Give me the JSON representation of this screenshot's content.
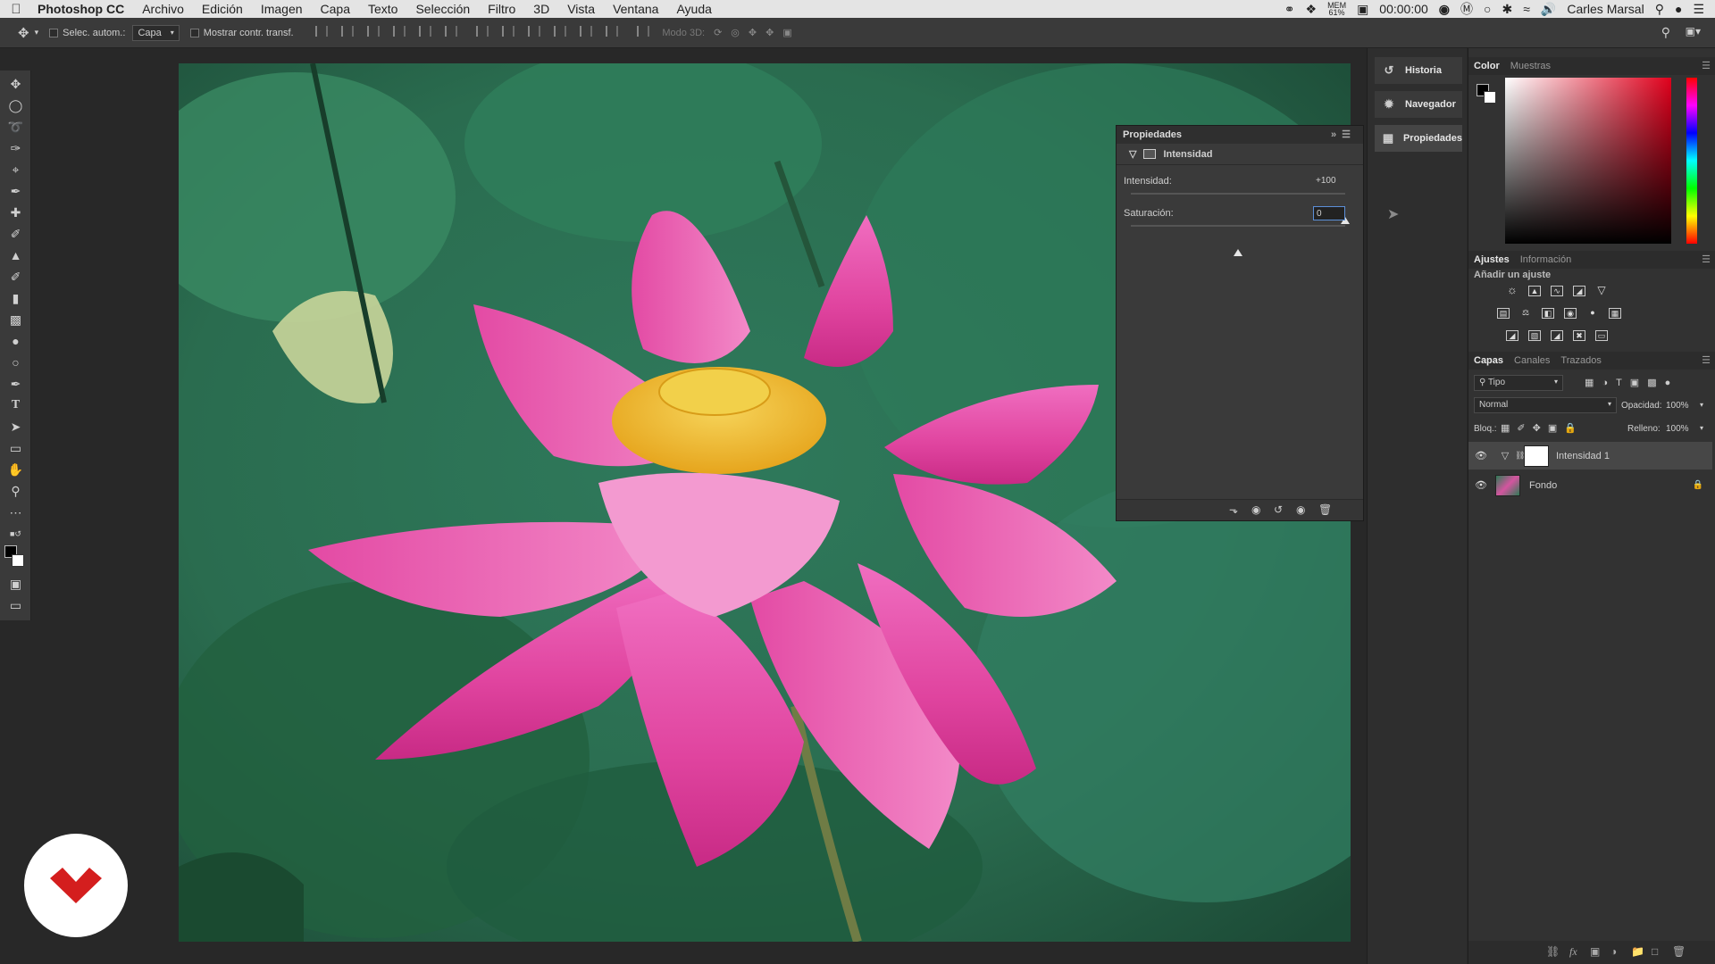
{
  "menubar": {
    "app_name": "Photoshop CC",
    "items": [
      "Archivo",
      "Edición",
      "Imagen",
      "Capa",
      "Texto",
      "Selección",
      "Filtro",
      "3D",
      "Vista",
      "Ventana",
      "Ayuda"
    ],
    "mem_label": "MEM",
    "mem_value": "61%",
    "timer": "00:00:00",
    "user": "Carles Marsal"
  },
  "options_bar": {
    "auto_select_label": "Selec. autom.:",
    "auto_select_value": "Capa",
    "transform_label": "Mostrar contr. transf.",
    "mode_3d_label": "Modo 3D:"
  },
  "collapsed_panels": {
    "historia": "Historia",
    "navegador": "Navegador",
    "propiedades": "Propiedades"
  },
  "properties": {
    "title": "Propiedades",
    "subtitle": "Intensidad",
    "intensidad_label": "Intensidad:",
    "intensidad_value": "+100",
    "intensidad_level": 100,
    "saturacion_label": "Saturación:",
    "saturacion_value": "0",
    "saturacion_level": 0
  },
  "color_panel": {
    "tabs": [
      "Color",
      "Muestras"
    ],
    "foreground": "#000000",
    "background": "#ffffff"
  },
  "adjustments_panel": {
    "tabs": [
      "Ajustes",
      "Información"
    ],
    "heading": "Añadir un ajuste"
  },
  "layers_panel": {
    "tabs": [
      "Capas",
      "Canales",
      "Trazados"
    ],
    "filter_kind": "Tipo",
    "blend_mode": "Normal",
    "opacity_label": "Opacidad:",
    "opacity_value": "100%",
    "lock_label": "Bloq.:",
    "fill_label": "Relleno:",
    "fill_value": "100%",
    "layers": [
      {
        "name": "Intensidad 1"
      },
      {
        "name": "Fondo"
      }
    ]
  }
}
